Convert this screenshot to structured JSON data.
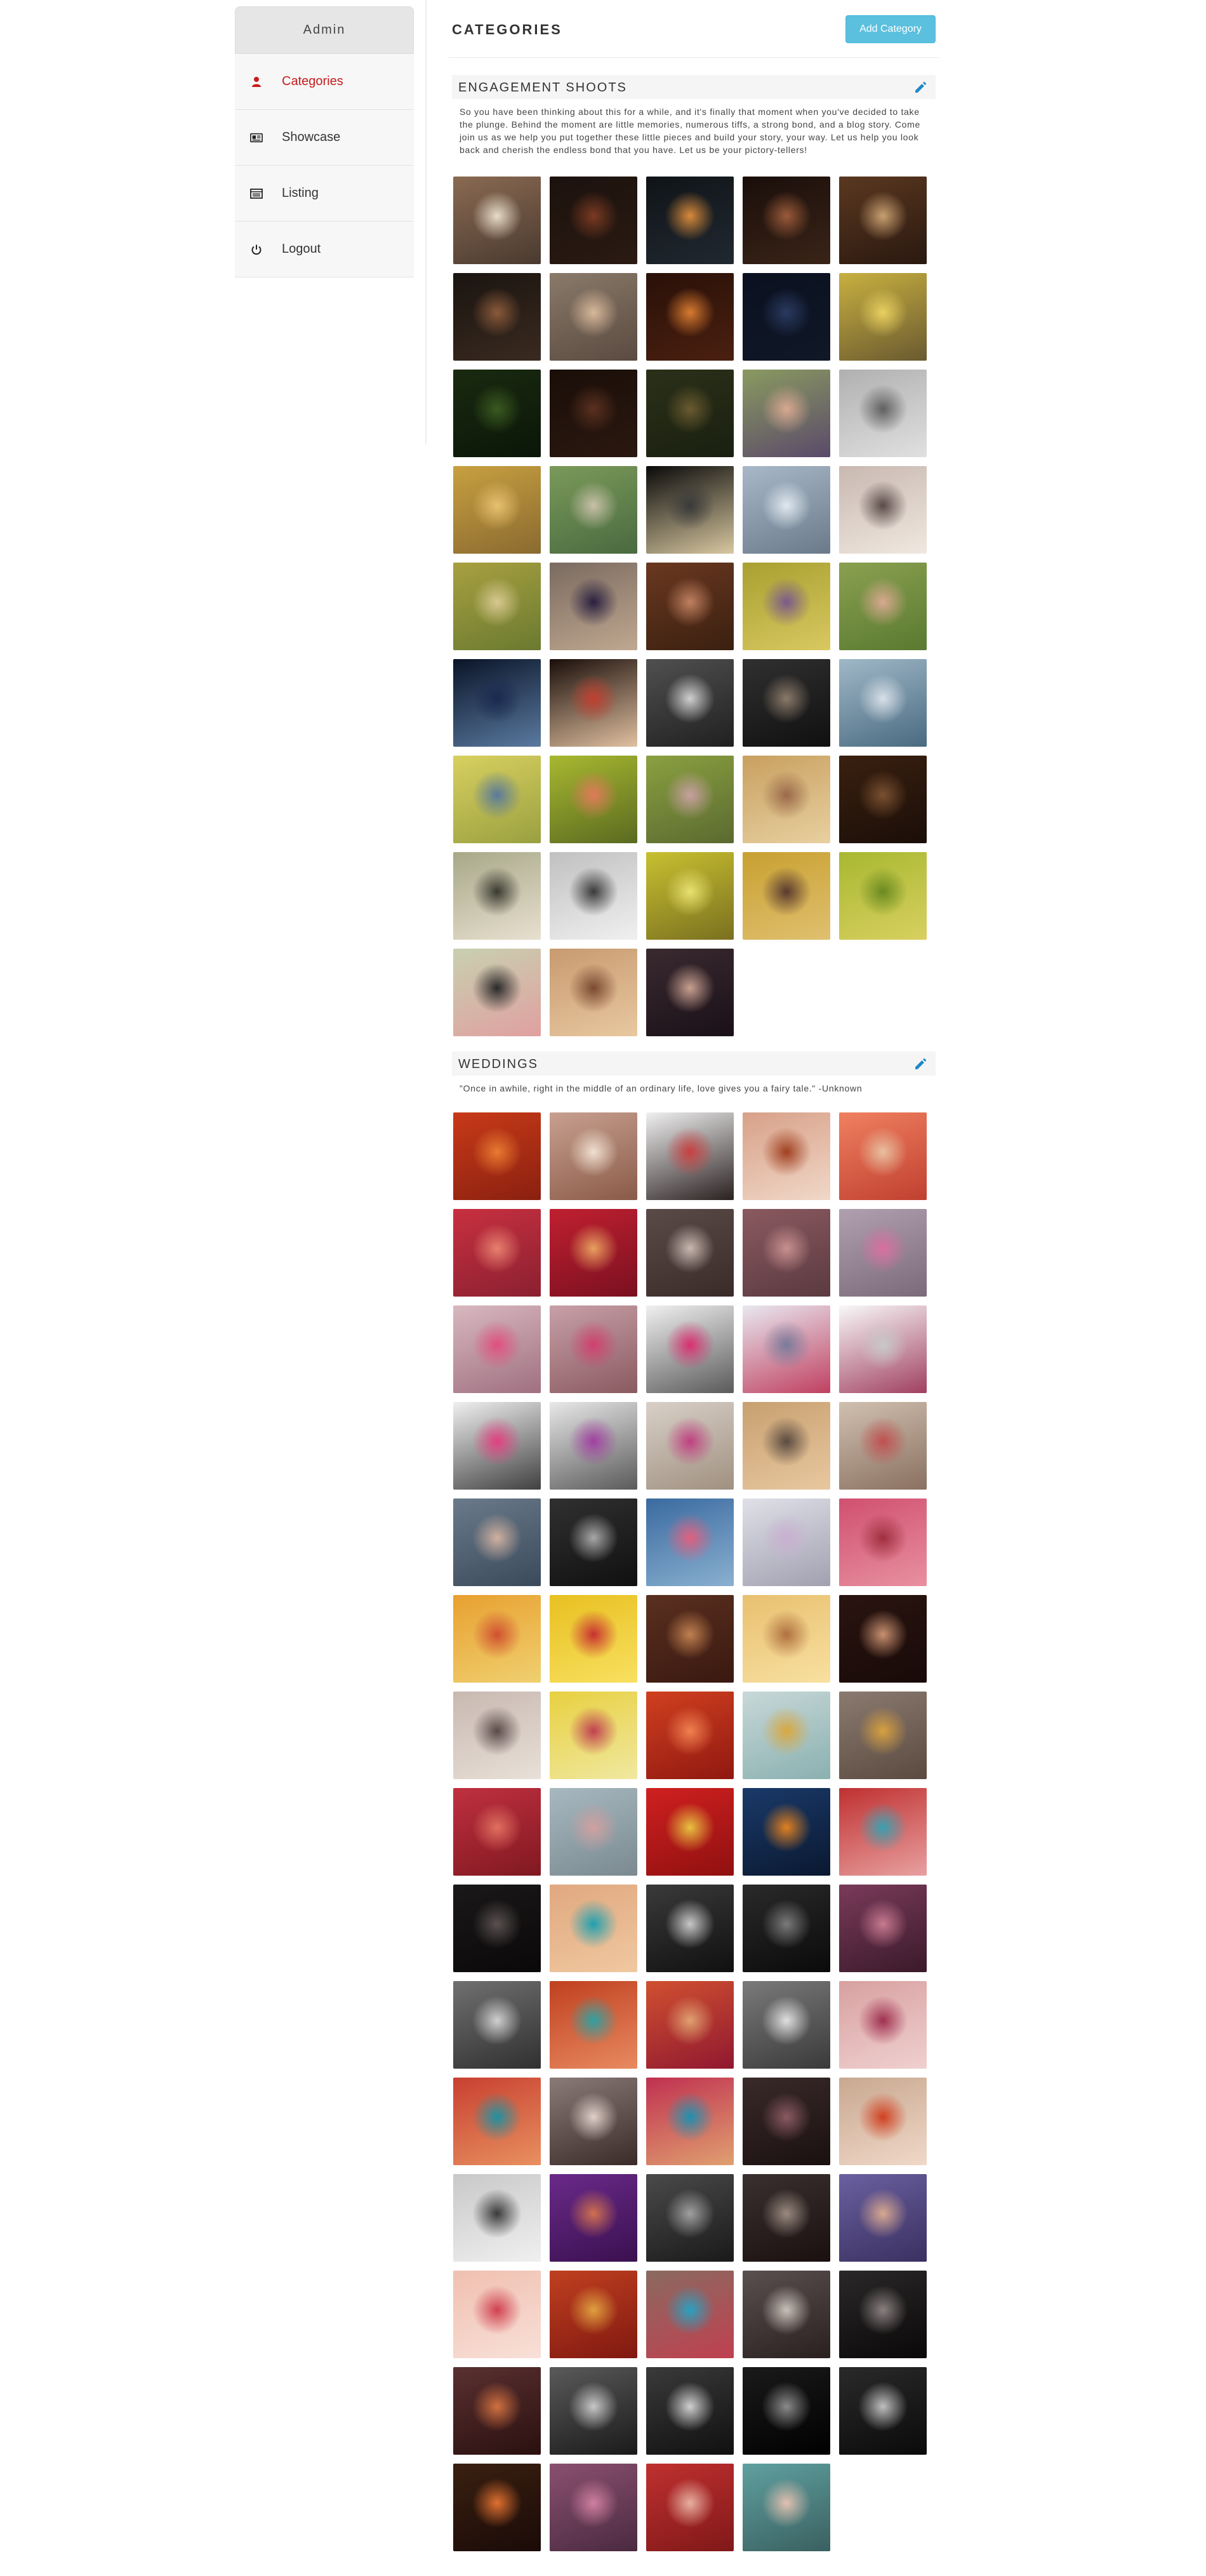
{
  "sidebar": {
    "header": "Admin",
    "items": [
      {
        "label": "Categories",
        "icon": "user-icon",
        "active": true
      },
      {
        "label": "Showcase",
        "icon": "id-card-icon",
        "active": false
      },
      {
        "label": "Listing",
        "icon": "list-icon",
        "active": false
      },
      {
        "label": "Logout",
        "icon": "power-icon",
        "active": false
      }
    ]
  },
  "header": {
    "title": "CATEGORIES",
    "add_button": "Add Category"
  },
  "colors": {
    "accent": "#5bc0de",
    "active": "#c71c1c",
    "edit_icon": "#1e88c7"
  },
  "categories": [
    {
      "title": "ENGAGEMENT SHOOTS",
      "description": "So you have been thinking about this for a while, and it's finally that moment when you've decided to take the plunge. Behind the moment are little memories, numerous tiffs, a strong bond, and a blog story. Come join us as we help you put together these little pieces and build your story, your way. Let us help you look back and cherish the endless bond that you have. Let us be your pictory-tellers!",
      "photo_count": 43,
      "photo_tones": [
        [
          "#8a6a52",
          "#e8dcc8",
          "#4a3a30"
        ],
        [
          "#1c120e",
          "#7a3a22",
          "#2a1a12"
        ],
        [
          "#101418",
          "#d88a3a",
          "#202830"
        ],
        [
          "#1a0e0a",
          "#9a5a3a",
          "#3a2418"
        ],
        [
          "#5a3820",
          "#c8a070",
          "#2a1810"
        ],
        [
          "#1a1410",
          "#8a5a3a",
          "#3a2a20"
        ],
        [
          "#8a7a6a",
          "#d8b89a",
          "#5a4a40"
        ],
        [
          "#2a1008",
          "#d87a30",
          "#4a2010"
        ],
        [
          "#0a1020",
          "#2a3a60",
          "#101828"
        ],
        [
          "#c8b040",
          "#e8d060",
          "#6a5a30"
        ],
        [
          "#1a2a10",
          "#3a5a20",
          "#0a1608"
        ],
        [
          "#1a0e08",
          "#5a3020",
          "#2a1810"
        ],
        [
          "#2a3018",
          "#6a5a30",
          "#1a2010"
        ],
        [
          "#8a9a60",
          "#d8a890",
          "#5a4a6a"
        ],
        [
          "#b0b0b0",
          "#606060",
          "#e0e0e0"
        ],
        [
          "#c8a040",
          "#e8c070",
          "#8a6a30"
        ],
        [
          "#7a9a5a",
          "#c8c0a8",
          "#4a6a40"
        ],
        [
          "#0a0a0a",
          "#3a3a3a",
          "#d8c8a0"
        ],
        [
          "#a8b8c8",
          "#e0e8f0",
          "#6a7a8a"
        ],
        [
          "#c8b8b0",
          "#5a4a48",
          "#f0e8e0"
        ],
        [
          "#a8a040",
          "#d8c890",
          "#6a7a30"
        ],
        [
          "#7a6a60",
          "#2a2040",
          "#c0a890"
        ],
        [
          "#6a3820",
          "#c08060",
          "#3a2010"
        ],
        [
          "#a8a030",
          "#7a5a8a",
          "#d8c860"
        ],
        [
          "#8aa050",
          "#d8a890",
          "#5a7a30"
        ],
        [
          "#0a1428",
          "#1a2a50",
          "#5a7aa0"
        ],
        [
          "#1a0e0a",
          "#c04030",
          "#e0c0a0"
        ],
        [
          "#505050",
          "#d0d0d0",
          "#202020"
        ],
        [
          "#303030",
          "#8a7a6a",
          "#101010"
        ],
        [
          "#a0b8c8",
          "#d8e0e8",
          "#4a6a80"
        ],
        [
          "#d8d060",
          "#5a7a9a",
          "#9aa040"
        ],
        [
          "#a8b830",
          "#e07a5a",
          "#5a6a20"
        ],
        [
          "#8aa040",
          "#c8a0a0",
          "#5a6a30"
        ],
        [
          "#c8a060",
          "#9a6a4a",
          "#e8d0a0"
        ],
        [
          "#3a2010",
          "#7a5030",
          "#1a0e08"
        ],
        [
          "#a8a888",
          "#3a3a30",
          "#e8e0d0"
        ],
        [
          "#c0c0c0",
          "#3a3a3a",
          "#f0f0f0"
        ],
        [
          "#c8c030",
          "#e8e070",
          "#7a7020"
        ],
        [
          "#c8a030",
          "#5a3a30",
          "#e0c070"
        ],
        [
          "#a8b830",
          "#6a8a20",
          "#d8d060"
        ],
        [
          "#c8d0b0",
          "#2a2a2a",
          "#e0a0a0"
        ],
        [
          "#c89a70",
          "#7a4a30",
          "#e8c8a0"
        ],
        [
          "#3a2a30",
          "#c8a090",
          "#1a1018"
        ]
      ]
    },
    {
      "title": "WEDDINGS",
      "description": "\"Once in awhile, right in the middle of an ordinary life, love gives you a fairy tale.\" -Unknown",
      "photo_count": 74,
      "photo_tones": [
        [
          "#c83a18",
          "#e87a30",
          "#8a2010"
        ],
        [
          "#c8a090",
          "#f0e0d0",
          "#8a5a48"
        ],
        [
          "#f0f0f0",
          "#c84040",
          "#2a2020"
        ],
        [
          "#d8a088",
          "#a04020",
          "#f0d8c8"
        ],
        [
          "#f08060",
          "#e8c0a0",
          "#c04030"
        ],
        [
          "#c83040",
          "#e88070",
          "#8a2030"
        ],
        [
          "#c02030",
          "#e8a060",
          "#7a1020"
        ],
        [
          "#5a4a48",
          "#c8b8b0",
          "#3a2a28"
        ],
        [
          "#8a5a60",
          "#c89090",
          "#5a3a40"
        ],
        [
          "#b0a0b0",
          "#d870a0",
          "#7a6a7a"
        ],
        [
          "#d8b8c0",
          "#e05080",
          "#a07080"
        ],
        [
          "#c8a0a8",
          "#d04070",
          "#8a5a60"
        ],
        [
          "#f0f0f0",
          "#d83070",
          "#5a5a5a"
        ],
        [
          "#e8e8f0",
          "#7a7a9a",
          "#c04060"
        ],
        [
          "#f8f8f8",
          "#c8c8c8",
          "#a04060"
        ],
        [
          "#f0f0f0",
          "#e04080",
          "#404040"
        ],
        [
          "#e8e8e8",
          "#a040a0",
          "#5a5a5a"
        ],
        [
          "#d8d0c8",
          "#c04080",
          "#a09080"
        ],
        [
          "#c8a070",
          "#5a4a40",
          "#e8c8a0"
        ],
        [
          "#d0c0b0",
          "#c05050",
          "#8a7060"
        ],
        [
          "#6a7a8a",
          "#d0b0a0",
          "#3a4a5a"
        ],
        [
          "#303030",
          "#a8a8a8",
          "#101010"
        ],
        [
          "#3a6aa0",
          "#e06080",
          "#8ab0d0"
        ],
        [
          "#e0e0e8",
          "#c8b0d0",
          "#a0a0b0"
        ],
        [
          "#d05070",
          "#a03040",
          "#e890a0"
        ],
        [
          "#e8a030",
          "#d05030",
          "#f0d070"
        ],
        [
          "#e8c020",
          "#c83030",
          "#f8e060"
        ],
        [
          "#5a3020",
          "#c08050",
          "#3a1810"
        ],
        [
          "#e8c070",
          "#b07040",
          "#f8e0a0"
        ],
        [
          "#2a1410",
          "#c89070",
          "#180a08"
        ],
        [
          "#c8b8b0",
          "#5a4a48",
          "#e8e0d8"
        ],
        [
          "#e8d040",
          "#c04050",
          "#f0e8a0"
        ],
        [
          "#d04020",
          "#f08050",
          "#901810"
        ],
        [
          "#c8d8d8",
          "#d8a840",
          "#8ab0b0"
        ],
        [
          "#8a7a70",
          "#d8a040",
          "#5a4a40"
        ],
        [
          "#c03040",
          "#e07060",
          "#801820"
        ],
        [
          "#a8b8c0",
          "#d0a0a0",
          "#7a8a90"
        ],
        [
          "#d02020",
          "#e8c040",
          "#901010"
        ],
        [
          "#1a3a6a",
          "#e08020",
          "#0a1830"
        ],
        [
          "#c03030",
          "#3aa0b0",
          "#e8a0a0"
        ],
        [
          "#1a1818",
          "#5a5050",
          "#0a0808"
        ],
        [
          "#e0a880",
          "#20a0b0",
          "#f0c8a0"
        ],
        [
          "#3a3a3a",
          "#c8c8c8",
          "#101010"
        ],
        [
          "#2a2a2a",
          "#7a7a7a",
          "#0a0a0a"
        ],
        [
          "#7a3a5a",
          "#c87a90",
          "#3a1a2a"
        ],
        [
          "#707070",
          "#d0d0d0",
          "#303030"
        ],
        [
          "#c04020",
          "#30a0a0",
          "#e88a60"
        ],
        [
          "#d05030",
          "#e0a070",
          "#901830"
        ],
        [
          "#7a7a7a",
          "#e0e0e0",
          "#3a3a3a"
        ],
        [
          "#d8a0a0",
          "#a03050",
          "#f0d0d0"
        ],
        [
          "#c84030",
          "#2090a0",
          "#e89060"
        ],
        [
          "#8a7a78",
          "#e0d0c8",
          "#3a2a28"
        ],
        [
          "#c03050",
          "#2090b0",
          "#e0a070"
        ],
        [
          "#3a2a2a",
          "#8a5a60",
          "#1a1010"
        ],
        [
          "#c8a890",
          "#d04020",
          "#f0d8c8"
        ],
        [
          "#c8c8c8",
          "#3a3a3a",
          "#f0f0f0"
        ],
        [
          "#6a2a8a",
          "#d07050",
          "#3a1050"
        ],
        [
          "#4a4a4a",
          "#a0a0a0",
          "#1a1a1a"
        ],
        [
          "#3a3030",
          "#9a8a80",
          "#1a1010"
        ],
        [
          "#6a60a0",
          "#d8a890",
          "#3a3060"
        ],
        [
          "#f0c0b0",
          "#d04050",
          "#f8e0d8"
        ],
        [
          "#c04020",
          "#e0a040",
          "#801810"
        ],
        [
          "#8a6a60",
          "#2aa0c0",
          "#c04050"
        ],
        [
          "#5a5050",
          "#c8c0b8",
          "#2a2020"
        ],
        [
          "#2a2828",
          "#8a8080",
          "#0a0808"
        ],
        [
          "#5a3030",
          "#d07040",
          "#2a1010"
        ],
        [
          "#5a5a5a",
          "#c8c8c8",
          "#1a1a1a"
        ],
        [
          "#3a3a3a",
          "#d0d0d0",
          "#101010"
        ],
        [
          "#1a1a1a",
          "#8a8a8a",
          "#000000"
        ],
        [
          "#2a2a2a",
          "#c0c0c0",
          "#0a0a0a"
        ],
        [
          "#3a2010",
          "#e07030",
          "#1a0a08"
        ],
        [
          "#8a5070",
          "#d080a0",
          "#4a2a40"
        ],
        [
          "#c03030",
          "#e8b0a0",
          "#801818"
        ],
        [
          "#60a0a0",
          "#e0c0b0",
          "#3a6060"
        ]
      ]
    }
  ]
}
